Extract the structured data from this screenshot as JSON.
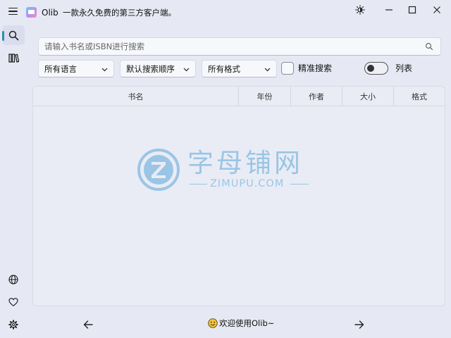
{
  "app": {
    "title": "Olib",
    "subtitle": "一款永久免费的第三方客户端。"
  },
  "window_controls": [
    "theme-icon",
    "minimize-icon",
    "maximize-icon",
    "close-icon"
  ],
  "nav": {
    "top_items": [
      {
        "name": "search",
        "icon": "search-icon",
        "active": true
      },
      {
        "name": "library",
        "icon": "library-icon",
        "active": false
      }
    ],
    "bottom_items": [
      {
        "name": "globe",
        "icon": "globe-icon"
      },
      {
        "name": "favorites",
        "icon": "heart-icon"
      },
      {
        "name": "settings",
        "icon": "gear-icon"
      }
    ]
  },
  "search": {
    "placeholder": "请输入书名或ISBN进行搜索",
    "value": ""
  },
  "filters": {
    "language": "所有语言",
    "sort": "默认搜索顺序",
    "format": "所有格式",
    "exact_label": "精准搜索",
    "exact_checked": false,
    "list_label": "列表",
    "list_on": false
  },
  "table": {
    "columns": [
      "书名",
      "年份",
      "作者",
      "大小",
      "格式"
    ],
    "rows": []
  },
  "watermark": {
    "zh": "字母铺网",
    "en": "ZIMUPU.COM"
  },
  "footer": {
    "welcome": "欢迎使用Olib~"
  },
  "colors": {
    "background": "#e6e9f3",
    "accent": "#2f8fb0",
    "watermark": "#5aa7d9"
  }
}
